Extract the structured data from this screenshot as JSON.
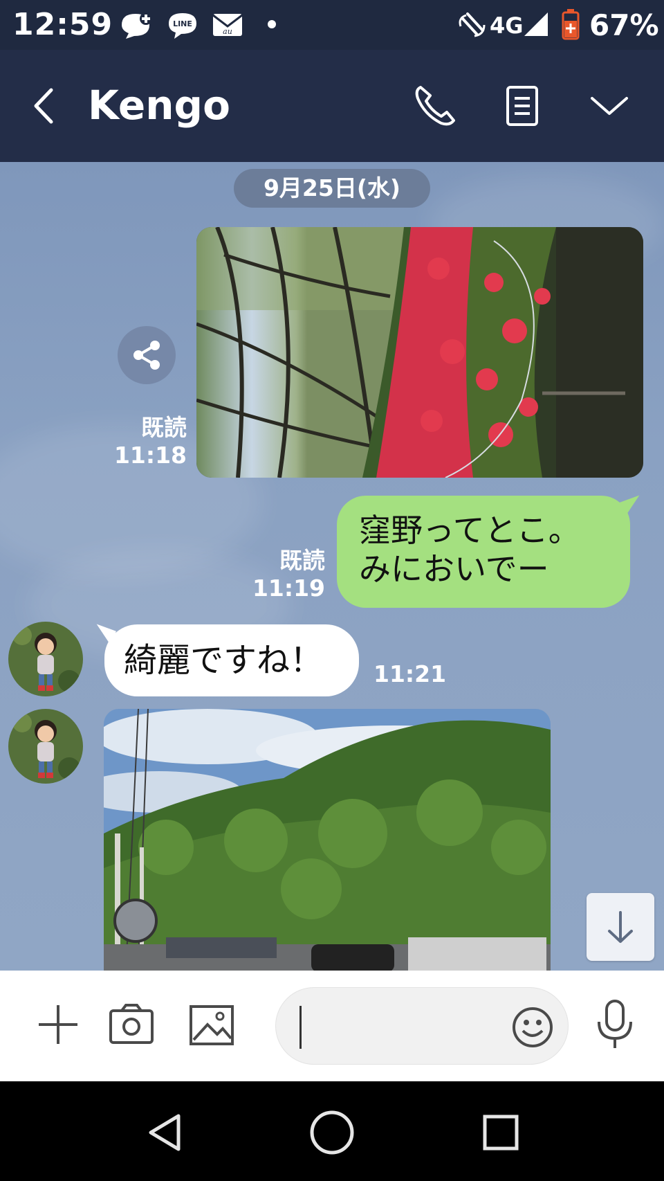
{
  "status_bar": {
    "time": "12:59",
    "network": "4G",
    "battery": "67%",
    "icons": [
      "chat-plus-icon",
      "line-icon",
      "au-mail-icon",
      "dot-icon",
      "nfc-icon",
      "signal-icon",
      "battery-icon"
    ]
  },
  "header": {
    "title": "Kengo",
    "icons": [
      "back-icon",
      "phone-icon",
      "notes-icon",
      "chevron-down-icon"
    ]
  },
  "chat": {
    "date": "9月25日(水)",
    "messages": [
      {
        "type": "image",
        "sender": "me",
        "read": "既読",
        "time": "11:18"
      },
      {
        "type": "text",
        "sender": "me",
        "line1": "窪野ってとこ。",
        "line2": "みにおいでー",
        "read": "既読",
        "time": "11:19"
      },
      {
        "type": "text",
        "sender": "other",
        "text": "綺麗ですね！",
        "time": "11:21"
      },
      {
        "type": "image",
        "sender": "other"
      }
    ]
  },
  "input_bar": {
    "placeholder": "",
    "icons": [
      "plus-icon",
      "camera-icon",
      "image-icon",
      "emoji-icon",
      "mic-icon"
    ]
  },
  "nav_bar": {
    "icons": [
      "nav-back-icon",
      "nav-home-icon",
      "nav-recents-icon"
    ]
  },
  "colors": {
    "header_bg": "#232d48",
    "chat_bg": "#8aa1c2",
    "green_bubble": "#a4e080",
    "white_bubble": "#ffffff"
  }
}
